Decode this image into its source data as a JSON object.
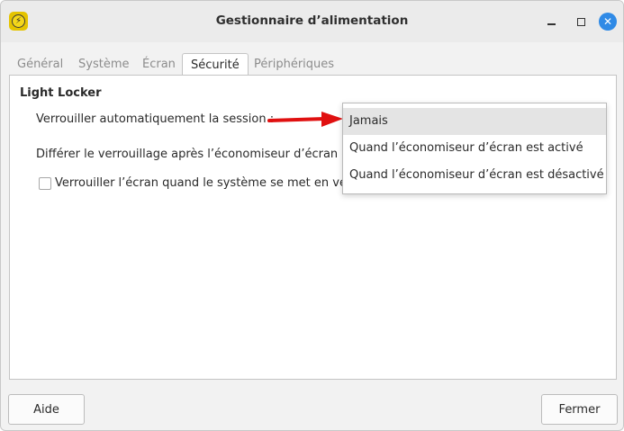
{
  "window": {
    "title": "Gestionnaire d’alimentation",
    "app_icon": "power-manager-icon",
    "controls": {
      "minimize": "minimize-icon",
      "maximize": "maximize-icon",
      "close": "✕"
    }
  },
  "tabs": [
    {
      "label": "Général",
      "active": false
    },
    {
      "label": "Système",
      "active": false
    },
    {
      "label": "Écran",
      "active": false
    },
    {
      "label": "Sécurité",
      "active": true
    },
    {
      "label": "Périphériques",
      "active": false
    }
  ],
  "security": {
    "section_title": "Light Locker",
    "auto_lock_label": "Verrouiller automatiquement la session :",
    "delay_label": "Différer le verrouillage après l’économiseur d’écran de",
    "sleep_lock_label": "Verrouiller l’écran quand le système se met en veille",
    "sleep_lock_checked": false
  },
  "dropdown": {
    "options": [
      "Jamais",
      "Quand l’économiseur d’écran est activé",
      "Quand l’économiseur d’écran est désactivé"
    ],
    "selected_index": 0
  },
  "annotation": {
    "arrow_color": "#e01010"
  },
  "footer": {
    "help_label": "Aide",
    "close_label": "Fermer"
  }
}
